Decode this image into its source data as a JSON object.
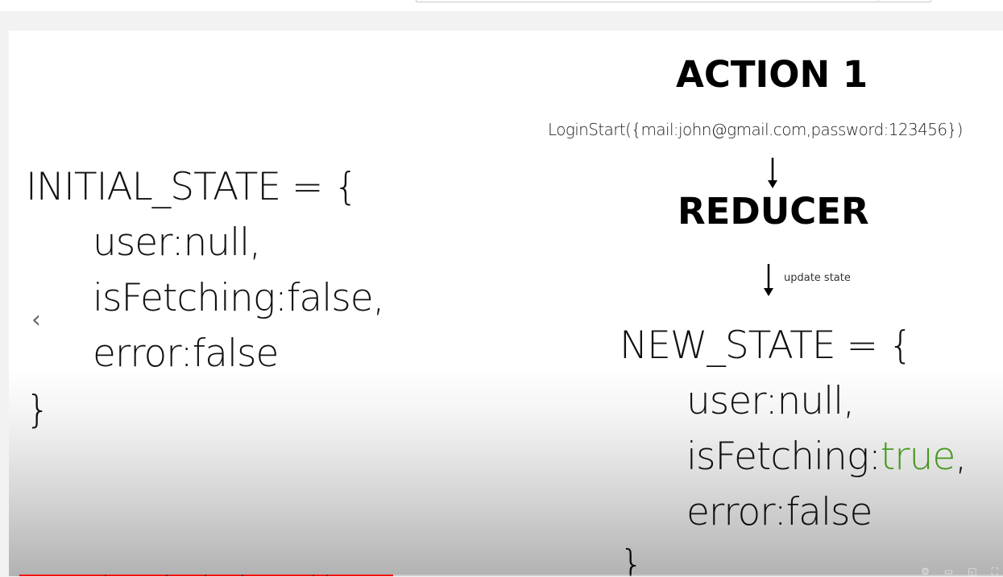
{
  "slide": {
    "initial_state": {
      "open": "INITIAL_STATE = {",
      "user": "user:null,",
      "fetching": "isFetching:false,",
      "error": "error:false",
      "close": "}"
    },
    "action_title": "ACTION 1",
    "action_call": "LoginStart({mail:john@gmail.com,password:123456})",
    "reducer_title": "REDUCER",
    "update_label": "update state",
    "new_state": {
      "open": "NEW_STATE = {",
      "user": "user:null,",
      "fetching_key": "isFetching:",
      "fetching_value": "true",
      "fetching_comma": ",",
      "error": "error:false",
      "close": "}"
    },
    "highlight_color": "#4caa1e"
  },
  "player": {
    "nav_previous_icon": "chevron-left-icon",
    "progress_played_fraction": 0.38,
    "progress_color": "#ff0000"
  }
}
